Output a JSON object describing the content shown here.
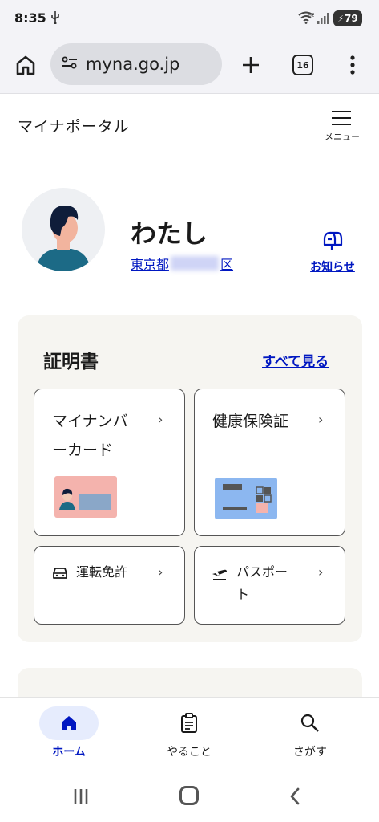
{
  "status_bar": {
    "time": "8:35",
    "battery": "79",
    "network": "6E"
  },
  "browser": {
    "url": "myna.go.jp",
    "tab_count": "16"
  },
  "header": {
    "site_title": "マイナポータル",
    "menu_label": "メニュー"
  },
  "profile": {
    "name": "わたし",
    "address_prefix": "東京都",
    "address_suffix": "区",
    "notice_label": "お知らせ"
  },
  "certificates": {
    "title": "証明書",
    "see_all": "すべて見る",
    "tiles": [
      {
        "line1": "マイナンバ",
        "line2": "ーカード"
      },
      {
        "line1": "健康保険証",
        "line2": ""
      },
      {
        "line1": "運転免許",
        "line2": ""
      },
      {
        "line1": "パスポー",
        "line2": "ト"
      }
    ]
  },
  "bottom_nav": {
    "items": [
      {
        "label": "ホーム"
      },
      {
        "label": "やること"
      },
      {
        "label": "さがす"
      }
    ]
  },
  "colors": {
    "accent": "#0017c1",
    "card_bg": "#f6f5f1",
    "card_pink": "#f4b3ad",
    "card_blue": "#8cb7f0"
  }
}
